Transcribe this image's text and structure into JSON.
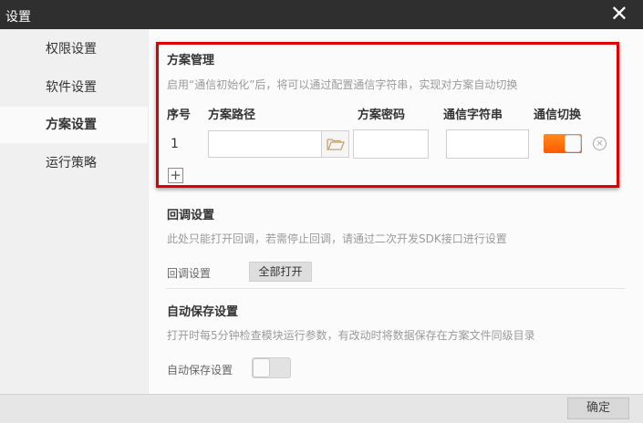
{
  "window": {
    "title": "设置",
    "close_symbol": "✕"
  },
  "sidebar": {
    "items": [
      {
        "label": "权限设置",
        "active": false
      },
      {
        "label": "软件设置",
        "active": false
      },
      {
        "label": "方案设置",
        "active": true
      },
      {
        "label": "运行策略",
        "active": false
      }
    ]
  },
  "scheme": {
    "title": "方案管理",
    "description": "启用“通信初始化”后，将可以通过配置通信字符串，实现对方案自动切换",
    "columns": {
      "index": "序号",
      "path": "方案路径",
      "key": "方案密码",
      "comm_string": "通信字符串",
      "switch": "通信切换"
    },
    "rows": [
      {
        "index": "1",
        "path": "",
        "key": "",
        "comm_string": "",
        "switch_on": true
      }
    ],
    "add_symbol": "+",
    "delete_symbol": "×"
  },
  "callback": {
    "title": "回调设置",
    "description": "此处只能打开回调，若需停止回调，请通过二次开发SDK接口进行设置",
    "label": "回调设置",
    "button": "全部打开"
  },
  "autosave": {
    "title": "自动保存设置",
    "description": "打开时每5分钟检查模块运行参数，有改动时将数据保存在方案文件同级目录",
    "label": "自动保存设置",
    "enabled": false
  },
  "footer": {
    "ok": "确定"
  },
  "colors": {
    "highlight_border": "#e10000",
    "toggle_on": "#ff6a00",
    "titlebar": "#2f2f2f"
  }
}
